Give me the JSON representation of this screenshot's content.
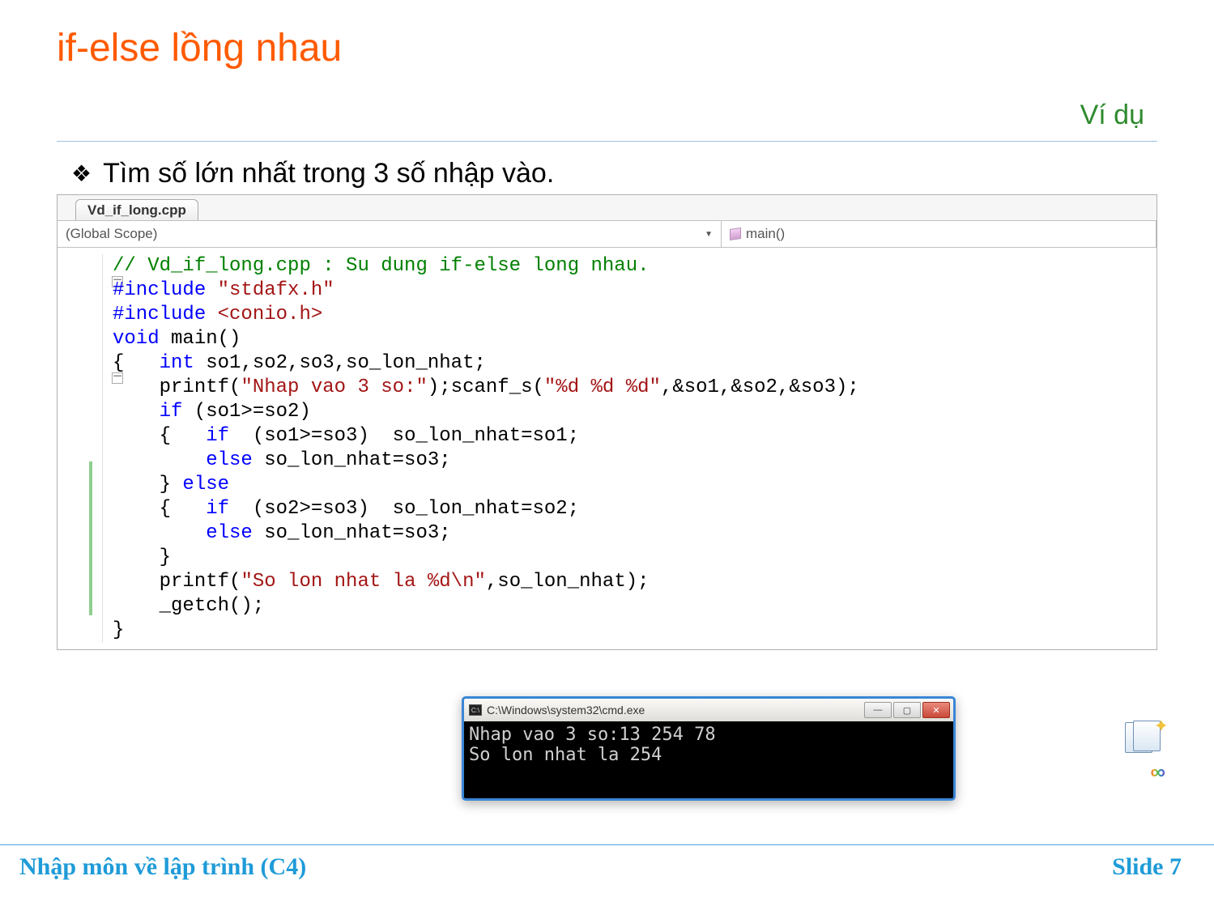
{
  "header": {
    "title": "if-else lồng nhau",
    "subtitle": "Ví dụ"
  },
  "bullet": {
    "symbol": "❖",
    "text": "Tìm số lớn nhất trong 3 số nhập vào."
  },
  "ide": {
    "tab": "Vd_if_long.cpp",
    "scope_left": "(Global Scope)",
    "scope_right": "main()",
    "code": {
      "l1_comment": "// Vd_if_long.cpp : Su dung if-else long nhau.",
      "l2a": "#include",
      "l2b": " \"stdafx.h\"",
      "l3a": "#include",
      "l3b": " <conio.h>",
      "l4a": "void",
      "l4b": " main()",
      "l5a": "{   ",
      "l5b": "int",
      "l5c": " so1,so2,so3,so_lon_nhat;",
      "l6a": "    printf(",
      "l6b": "\"Nhap vao 3 so:\"",
      "l6c": ");scanf_s(",
      "l6d": "\"%d %d %d\"",
      "l6e": ",&so1,&so2,&so3);",
      "l7a": "    ",
      "l7b": "if",
      "l7c": " (so1>=so2)",
      "l8a": "    {   ",
      "l8b": "if",
      "l8c": "  (so1>=so3)  so_lon_nhat=so1;",
      "l9a": "        ",
      "l9b": "else",
      "l9c": " so_lon_nhat=so3;",
      "l10a": "    } ",
      "l10b": "else",
      "l11a": "    {   ",
      "l11b": "if",
      "l11c": "  (so2>=so3)  so_lon_nhat=so2;",
      "l12a": "        ",
      "l12b": "else",
      "l12c": " so_lon_nhat=so3;",
      "l13": "    }",
      "l14a": "    printf(",
      "l14b": "\"So lon nhat la %d\\n\"",
      "l14c": ",so_lon_nhat);",
      "l15": "    _getch();",
      "l16": "}"
    }
  },
  "console": {
    "title": "C:\\Windows\\system32\\cmd.exe",
    "line1": "Nhap vao 3 so:13 254 78",
    "line2": "So lon nhat la 254"
  },
  "footer": {
    "left": "Nhập môn về lập trình (C4)",
    "right": "Slide 7"
  }
}
